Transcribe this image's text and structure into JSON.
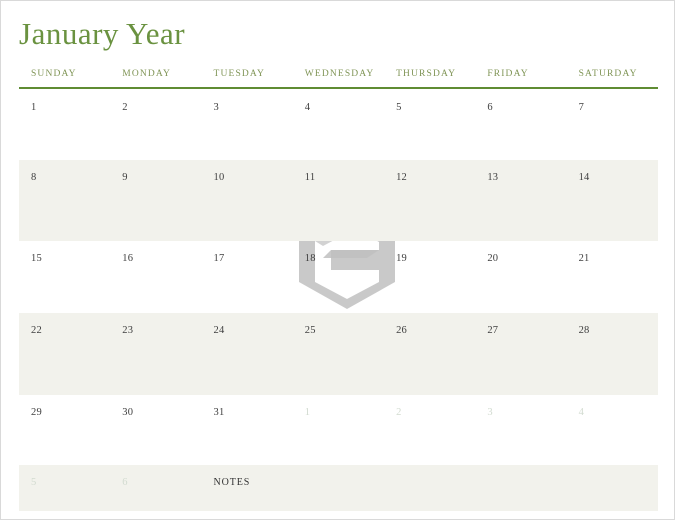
{
  "document": {
    "title": "January Year",
    "title_color": "#6a9240",
    "page_background": "#ffffff",
    "shaded_row_color": "#f2f2ec",
    "rule_color": "#5f8c33"
  },
  "weekday_headers": [
    "SUNDAY",
    "MONDAY",
    "TUESDAY",
    "WEDNESDAY",
    "THURSDAY",
    "FRIDAY",
    "SATURDAY"
  ],
  "weeks": [
    {
      "shaded": false,
      "days": [
        {
          "num": "1",
          "muted": false
        },
        {
          "num": "2",
          "muted": false
        },
        {
          "num": "3",
          "muted": false
        },
        {
          "num": "4",
          "muted": false
        },
        {
          "num": "5",
          "muted": false
        },
        {
          "num": "6",
          "muted": false
        },
        {
          "num": "7",
          "muted": false
        }
      ]
    },
    {
      "shaded": true,
      "days": [
        {
          "num": "8",
          "muted": false
        },
        {
          "num": "9",
          "muted": false
        },
        {
          "num": "10",
          "muted": false
        },
        {
          "num": "11",
          "muted": false
        },
        {
          "num": "12",
          "muted": false
        },
        {
          "num": "13",
          "muted": false
        },
        {
          "num": "14",
          "muted": false
        }
      ]
    },
    {
      "shaded": false,
      "days": [
        {
          "num": "15",
          "muted": false
        },
        {
          "num": "16",
          "muted": false
        },
        {
          "num": "17",
          "muted": false
        },
        {
          "num": "18",
          "muted": false
        },
        {
          "num": "19",
          "muted": false
        },
        {
          "num": "20",
          "muted": false
        },
        {
          "num": "21",
          "muted": false
        }
      ]
    },
    {
      "shaded": true,
      "days": [
        {
          "num": "22",
          "muted": false
        },
        {
          "num": "23",
          "muted": false
        },
        {
          "num": "24",
          "muted": false
        },
        {
          "num": "25",
          "muted": false
        },
        {
          "num": "26",
          "muted": false
        },
        {
          "num": "27",
          "muted": false
        },
        {
          "num": "28",
          "muted": false
        }
      ]
    },
    {
      "shaded": false,
      "days": [
        {
          "num": "29",
          "muted": false
        },
        {
          "num": "30",
          "muted": false
        },
        {
          "num": "31",
          "muted": false
        },
        {
          "num": "1",
          "muted": true
        },
        {
          "num": "2",
          "muted": true
        },
        {
          "num": "3",
          "muted": true
        },
        {
          "num": "4",
          "muted": true
        }
      ]
    },
    {
      "shaded": true,
      "days": [
        {
          "num": "5",
          "muted": true
        },
        {
          "num": "6",
          "muted": true
        },
        {
          "num": "",
          "muted": false
        },
        {
          "num": "",
          "muted": false
        },
        {
          "num": "",
          "muted": false
        },
        {
          "num": "",
          "muted": false
        },
        {
          "num": "",
          "muted": false
        }
      ]
    }
  ],
  "notes": {
    "label": "NOTES"
  },
  "watermark": {
    "name": "hexagon-e-logo",
    "gray": "#c9c9c9",
    "gray_dark": "#bfbfbf",
    "green": "#a9cbb4"
  }
}
